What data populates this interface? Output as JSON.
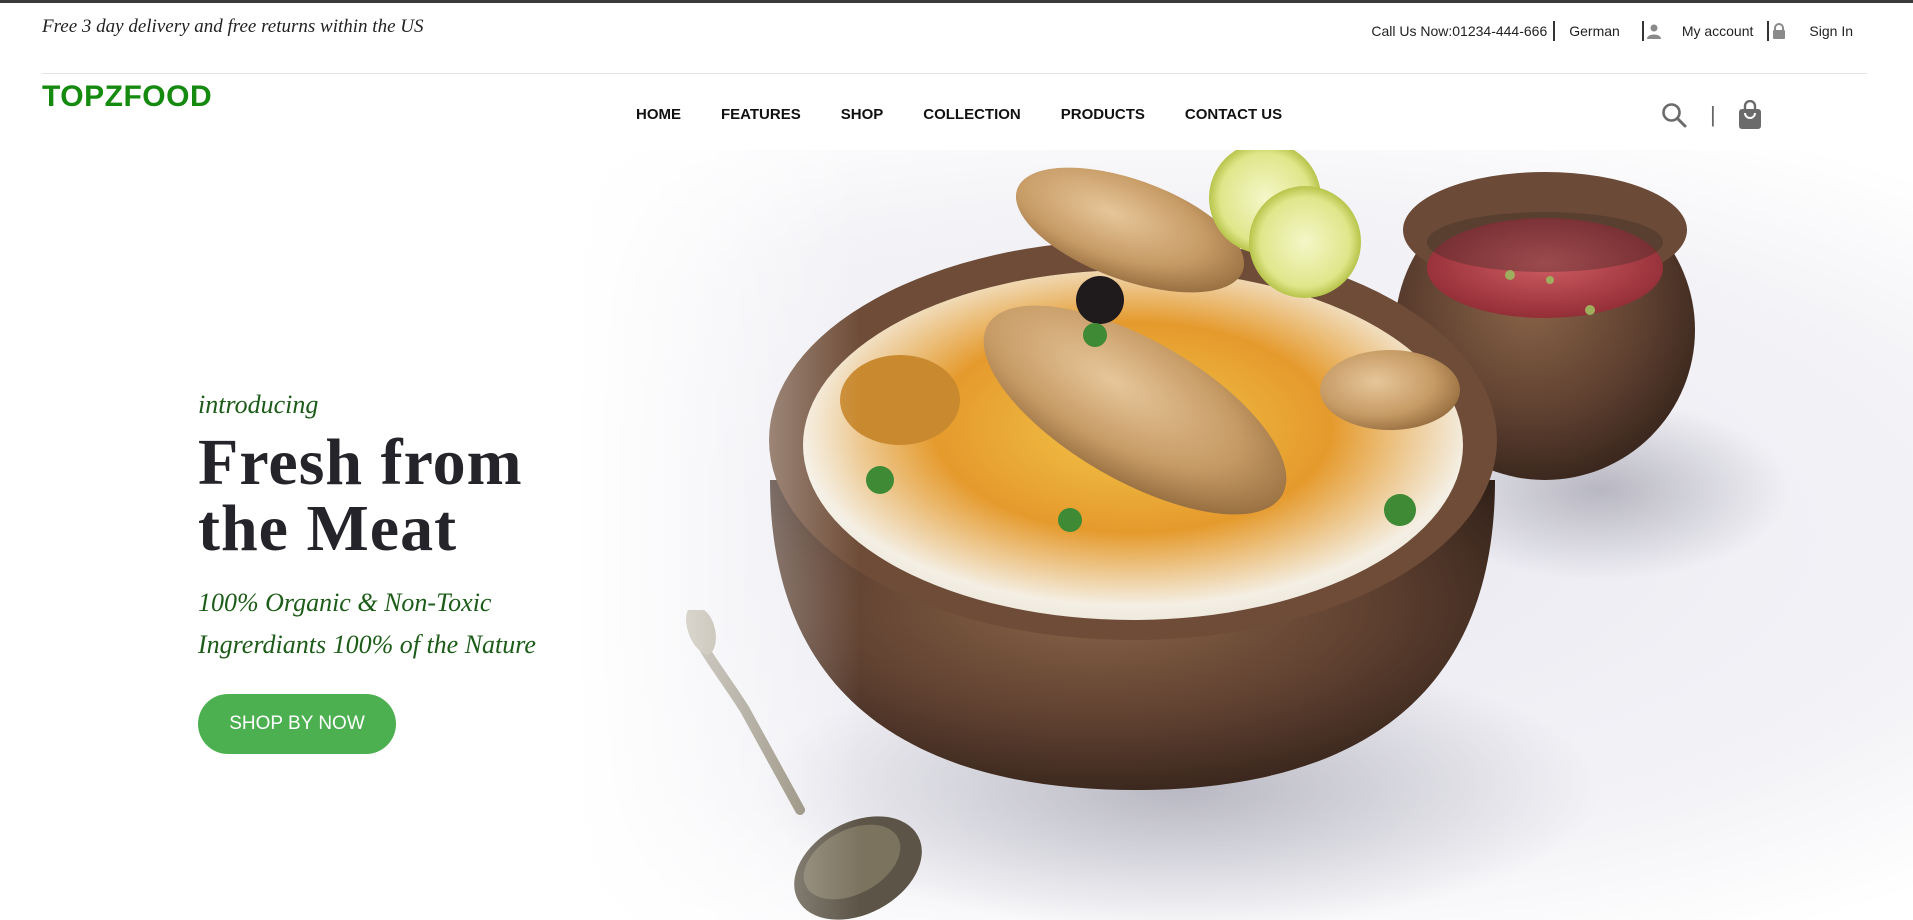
{
  "topbar": {
    "promo": "Free 3 day delivery and free returns within the US",
    "call": "Call Us Now:01234-444-666",
    "language": "German",
    "account": "My account",
    "signin": "Sign In"
  },
  "header": {
    "logo": "TOPZFOOD",
    "nav": [
      "HOME",
      "FEATURES",
      "SHOP",
      "COLLECTION",
      "PRODUCTS",
      "CONTACT US"
    ],
    "icons": [
      "search-icon",
      "shopping-bag-icon"
    ]
  },
  "hero": {
    "intro": "introducing",
    "headline_line1": "Fresh from",
    "headline_line2": "the Meat",
    "sub_line1": "100% Organic & Non-Toxic",
    "sub_line2": "Ingrerdiants 100% of the Nature",
    "cta": "SHOP BY NOW"
  },
  "colors": {
    "brand": "#148a0f",
    "accent_text": "#1c5c18",
    "cta": "#4caf50"
  }
}
